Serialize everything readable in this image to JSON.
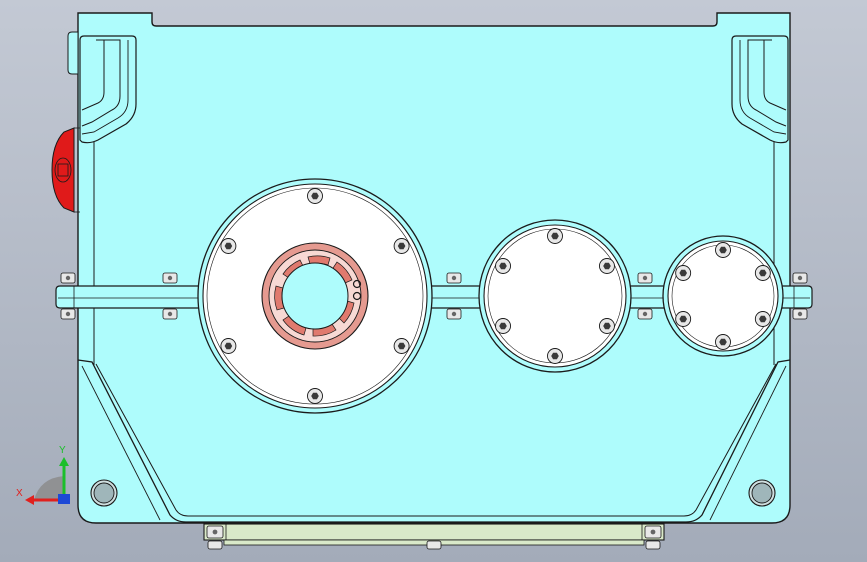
{
  "viewport": {
    "background_top": "#c3c9d4",
    "background_bottom": "#a3abb9"
  },
  "model": {
    "body_color": "#aefcfc",
    "edge_color": "#1a1a1a",
    "cover_color": "#ffffff",
    "seal_color": "#e59a90",
    "drain_plug_color": "#e01a1a",
    "base_rail_color": "#d9e9c9",
    "bolt_color": "#e8e8e8"
  },
  "triad": {
    "x_label": "X",
    "y_label": "Y",
    "x_color": "#e0201e",
    "y_color": "#1bbf2a",
    "z_color": "#1d49d6",
    "origin_color": "#8c8c8c"
  }
}
